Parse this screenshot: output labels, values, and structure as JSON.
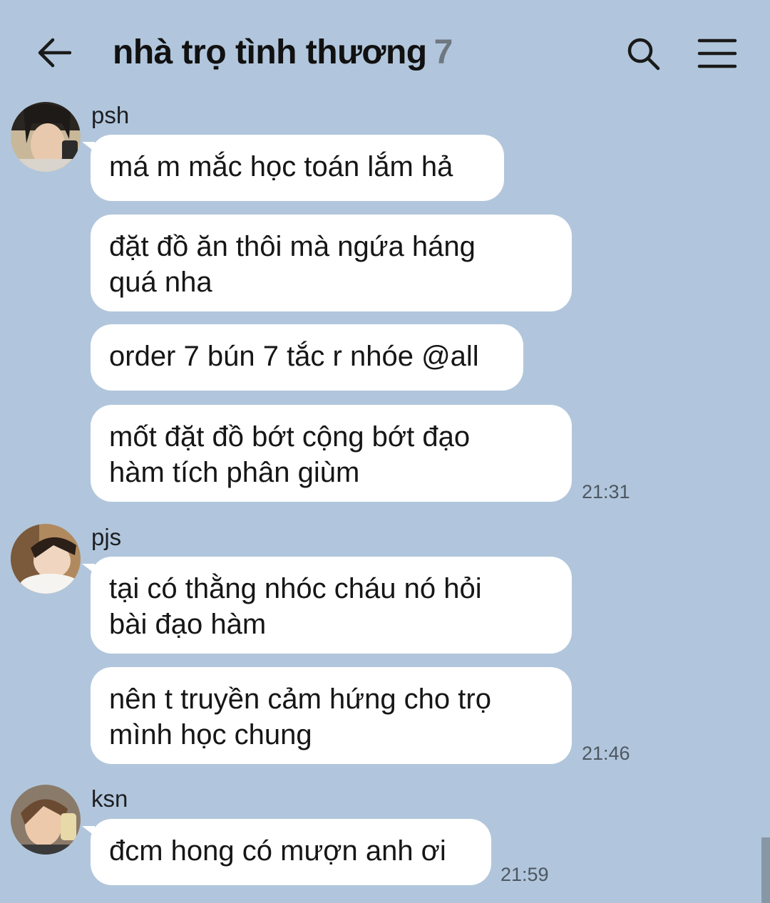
{
  "header": {
    "title": "nhà trọ tình thương",
    "member_count": "7"
  },
  "messages": [
    {
      "sender": "psh",
      "lines": [
        "má m mắc học toán lắm hả",
        "đặt đồ ăn thôi mà ngứa háng\nquá nha",
        "order 7 bún 7 tắc r nhóe @all",
        "mốt đặt đồ bớt cộng bớt đạo\nhàm tích phân giùm"
      ],
      "time": "21:31"
    },
    {
      "sender": "pjs",
      "lines": [
        "tại có thằng nhóc cháu nó hỏi\nbài đạo hàm",
        "nên t truyền cảm hứng cho trọ\nmình học chung"
      ],
      "time": "21:46"
    },
    {
      "sender": "ksn",
      "lines": [
        "đcm hong có mượn anh ơi"
      ],
      "time": "21:59"
    }
  ],
  "colors": {
    "background": "#b1c6dc",
    "bubble": "#ffffff",
    "count": "#6f7780"
  }
}
